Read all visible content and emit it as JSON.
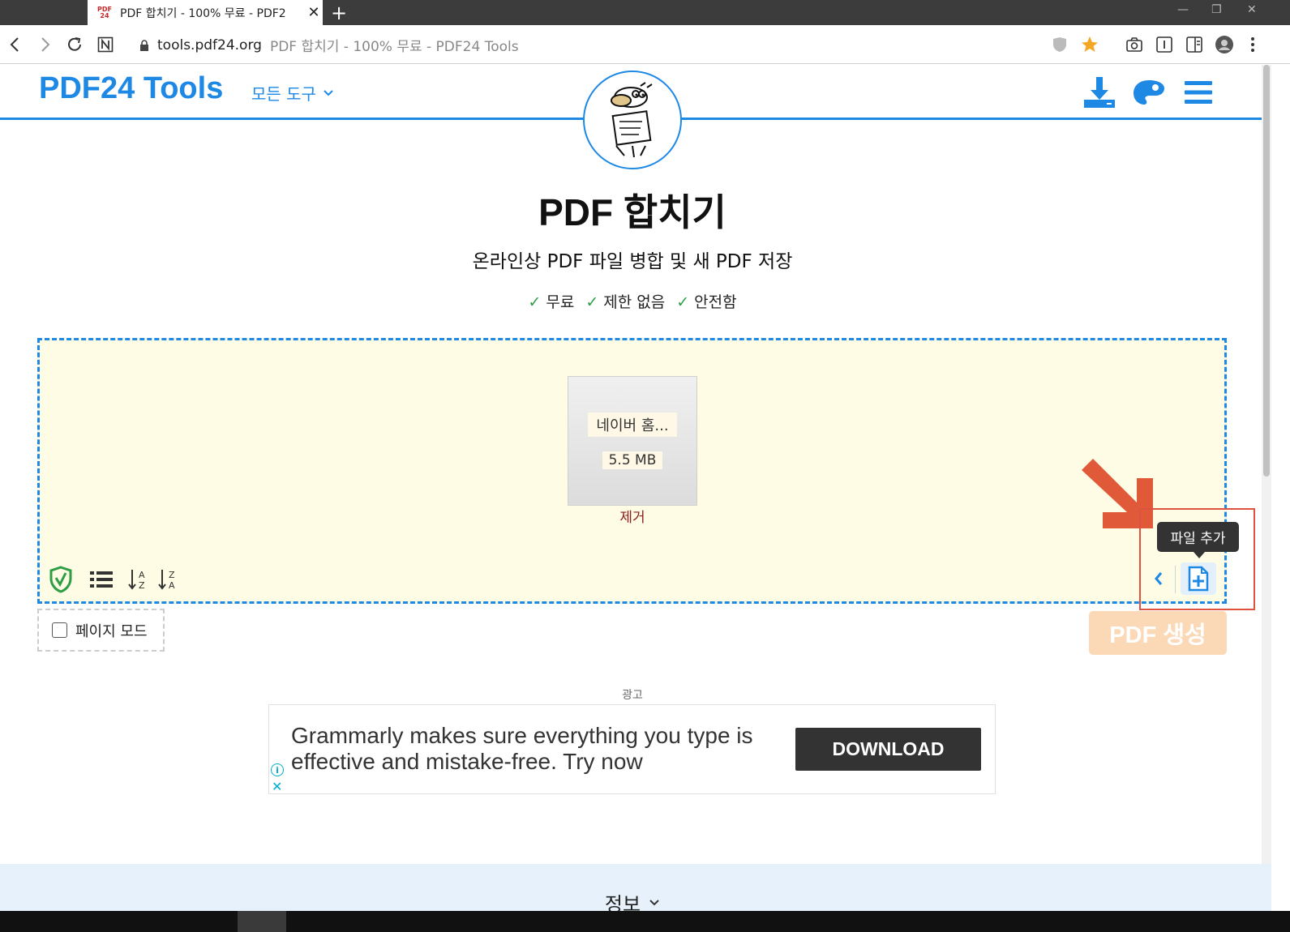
{
  "browser": {
    "tab": {
      "favicon_text_top": "PDF",
      "favicon_text_bottom": "24",
      "title": "PDF 합치기 - 100% 무료 - PDF2",
      "close_glyph": "✕"
    },
    "new_tab_glyph": "+",
    "url": "tools.pdf24.org",
    "url_page_title": "PDF 합치기 - 100% 무료 - PDF24 Tools"
  },
  "header": {
    "logo": "PDF24 Tools",
    "all_tools": "모든 도구",
    "brand_color": "#1e88e5"
  },
  "hero": {
    "title": "PDF 합치기",
    "subtitle": "온라인상 PDF 파일 병합 및 새 PDF 저장",
    "features": [
      {
        "check": "✓",
        "label": "무료"
      },
      {
        "check": "✓",
        "label": "제한 없음"
      },
      {
        "check": "✓",
        "label": "안전함"
      }
    ]
  },
  "upload": {
    "file": {
      "name": "네이버 홈...",
      "size": "5.5 MB",
      "remove_label": "제거"
    },
    "tooltip": "파일 추가",
    "page_mode_label": "페이지 모드",
    "create_button": "PDF 생성",
    "highlight_color": "#e05240"
  },
  "ad": {
    "label": "광고",
    "text": "Grammarly makes sure everything you type is effective and mistake-free. Try now",
    "button": "DOWNLOAD",
    "info_glyph": "i",
    "close_glyph": "✕"
  },
  "footer": {
    "info_title": "정보"
  }
}
